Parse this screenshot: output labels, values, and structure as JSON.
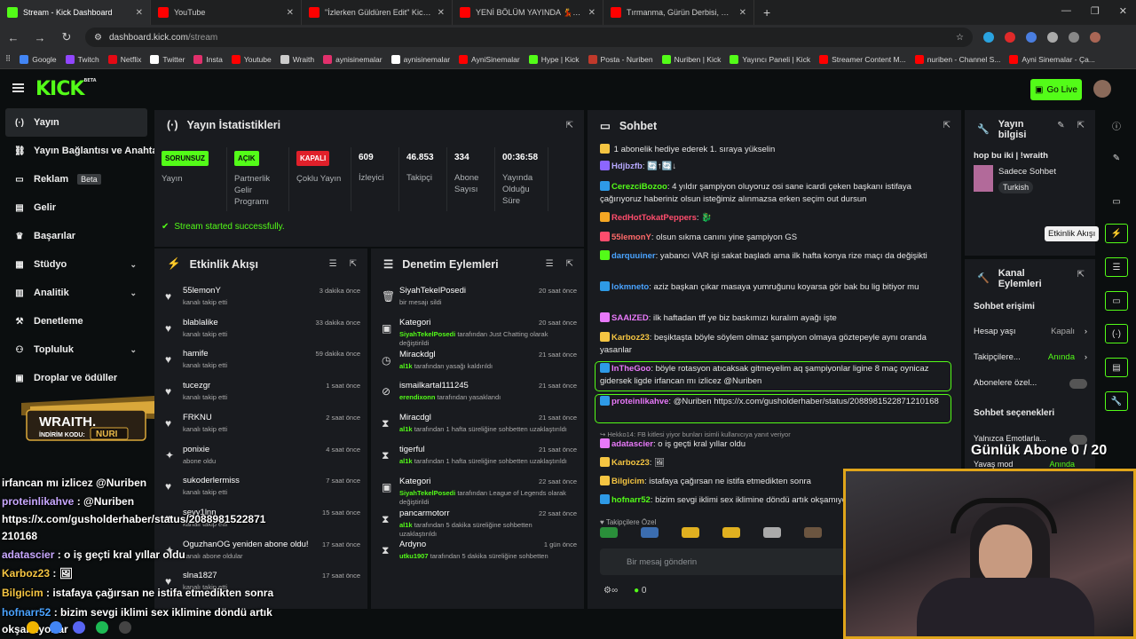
{
  "browser": {
    "tabs": [
      {
        "title": "Stream - Kick Dashboard",
        "color": "#53fc18"
      },
      {
        "title": "YouTube",
        "color": "#ff0000"
      },
      {
        "title": "\"İzlerken Güldüren Edit\" Kick &",
        "color": "#ff0000"
      },
      {
        "title": "YENİ BÖLÜM YAYINDA 💃 @C",
        "color": "#ff0000"
      },
      {
        "title": "Tırmanma, Gürün Derbisi, Yüksı",
        "color": "#ff0000"
      }
    ],
    "url_host": "dashboard.kick.com",
    "url_path": "/stream",
    "bookmarks": [
      {
        "label": "Google",
        "color": "#4285f4"
      },
      {
        "label": "Twitch",
        "color": "#9146ff"
      },
      {
        "label": "Netflix",
        "color": "#e50914"
      },
      {
        "label": "Twitter",
        "color": "#ffffff"
      },
      {
        "label": "Insta",
        "color": "#e1306c"
      },
      {
        "label": "Youtube",
        "color": "#ff0000"
      },
      {
        "label": "Wraith",
        "color": "#cccccc"
      },
      {
        "label": "aynisinemalar",
        "color": "#e1306c"
      },
      {
        "label": "aynisinemalar",
        "color": "#ffffff"
      },
      {
        "label": "AyniSinemalar",
        "color": "#ff0000"
      },
      {
        "label": "Hype | Kick",
        "color": "#53fc18"
      },
      {
        "label": "Posta - Nuriben",
        "color": "#c0392b"
      },
      {
        "label": "Nuriben | Kick",
        "color": "#53fc18"
      },
      {
        "label": "Yayıncı Paneli | Kick",
        "color": "#53fc18"
      },
      {
        "label": "Streamer Content M...",
        "color": "#ff0000"
      },
      {
        "label": "nuriben - Channel S...",
        "color": "#ff0000"
      },
      {
        "label": "Ayni Sinemalar - Ça...",
        "color": "#ff0000"
      }
    ]
  },
  "header": {
    "logo": "KICK",
    "logo_sup": "BETA",
    "go_live": "Go Live"
  },
  "sidebar": {
    "items": [
      {
        "label": "Yayın",
        "icon": "broadcast-icon"
      },
      {
        "label": "Yayın Bağlantısı ve Anahtarı",
        "icon": "link-icon"
      },
      {
        "label": "Reklam",
        "icon": "ad-icon",
        "badge": "Beta"
      },
      {
        "label": "Gelir",
        "icon": "money-icon"
      },
      {
        "label": "Başarılar",
        "icon": "trophy-icon"
      },
      {
        "label": "Stüdyo",
        "icon": "studio-icon"
      },
      {
        "label": "Analitik",
        "icon": "chart-icon"
      },
      {
        "label": "Denetleme",
        "icon": "hammer-icon"
      },
      {
        "label": "Topluluk",
        "icon": "community-icon"
      },
      {
        "label": "Droplar ve ödüller",
        "icon": "gift-icon"
      }
    ]
  },
  "stats": {
    "title": "Yayın İstatistikleri",
    "items": [
      {
        "badge": "SORUNSUZ",
        "badge_color": "#53fc18",
        "label": "Yayın"
      },
      {
        "badge": "AÇIK",
        "badge_color": "#53fc18",
        "label": "Partnerlik Gelir Programı"
      },
      {
        "badge": "KAPALI",
        "badge_color": "#e0202a",
        "label": "Çoklu Yayın"
      },
      {
        "value": "609",
        "label": "İzleyici"
      },
      {
        "value": "46.853",
        "label": "Takipçi"
      },
      {
        "value": "334",
        "label": "Abone Sayısı"
      },
      {
        "value": "00:36:58",
        "label": "Yayında Olduğu Süre"
      }
    ],
    "success": "Stream started successfully."
  },
  "activity": {
    "title": "Etkinlik Akışı",
    "rows": [
      {
        "name": "55lemonY",
        "sub": "kanalı takip etti",
        "time": "3 dakika önce",
        "icon": "heart-icon"
      },
      {
        "name": "blablalike",
        "sub": "kanalı takip etti",
        "time": "33 dakika önce",
        "icon": "heart-icon"
      },
      {
        "name": "hamife",
        "sub": "kanalı takip etti",
        "time": "59 dakika önce",
        "icon": "heart-icon"
      },
      {
        "name": "tucezgr",
        "sub": "kanalı takip etti",
        "time": "1 saat önce",
        "icon": "heart-icon"
      },
      {
        "name": "FRKNU",
        "sub": "kanalı takip etti",
        "time": "2 saat önce",
        "icon": "heart-icon"
      },
      {
        "name": "ponixie",
        "sub": "abone oldu",
        "time": "4 saat önce",
        "icon": "sparkle-icon"
      },
      {
        "name": "sukoderlermiss",
        "sub": "kanalı takip etti",
        "time": "7 saat önce",
        "icon": "heart-icon"
      },
      {
        "name": "seyy1lnn",
        "sub": "kanalı takip etti",
        "time": "15 saat önce",
        "icon": "heart-icon"
      },
      {
        "name": "OguzhanOG yeniden abone oldu!",
        "sub": "kanalı abone oldular",
        "time": "17 saat önce",
        "icon": "sparkle-icon"
      },
      {
        "name": "slna1827",
        "sub": "kanalı takip etti",
        "time": "17 saat önce",
        "icon": "heart-icon"
      }
    ]
  },
  "moderation": {
    "title": "Denetim Eylemleri",
    "rows": [
      {
        "name": "SiyahTekelPosedi",
        "sub": "bir mesajı sildi",
        "time": "20 saat önce",
        "icon": "trash-icon"
      },
      {
        "name": "Kategori",
        "sub_user": "SiyahTekelPosedi",
        "sub": " tarafından Just Chatting olarak değiştirildi",
        "time": "20 saat önce",
        "icon": "category-icon"
      },
      {
        "name": "Mirackdgl",
        "sub_user": "al1k",
        "sub": " tarafından yasağı kaldırıldı",
        "time": "21 saat önce",
        "icon": "clock-icon"
      },
      {
        "name": "ismailkartal111245",
        "sub_user": "erendixonn",
        "sub": " tarafından yasaklandı",
        "time": "21 saat önce",
        "icon": "ban-icon"
      },
      {
        "name": "Miracdgl",
        "sub_user": "al1k",
        "sub": " tarafından 1 hafta süreliğine sohbetten uzaklaştırıldı",
        "time": "21 saat önce",
        "icon": "hourglass-icon"
      },
      {
        "name": "tigerful",
        "sub_user": "al1k",
        "sub": " tarafından 1 hafta süreliğine sohbetten uzaklaştırıldı",
        "time": "21 saat önce",
        "icon": "hourglass-icon"
      },
      {
        "name": "Kategori",
        "sub_user": "SiyahTekelPosedi",
        "sub": " tarafından League of Legends olarak değiştirildi",
        "time": "22 saat önce",
        "icon": "category-icon"
      },
      {
        "name": "pancarmotorr",
        "sub_user": "al1k",
        "sub": " tarafından 5 dakika süreliğine sohbetten uzaklaştırıldı",
        "time": "22 saat önce",
        "icon": "hourglass-icon"
      },
      {
        "name": "Ardyno",
        "sub_user": "utku1907",
        "sub": " tarafından 5 dakika süreliğine sohbetten",
        "time": "1 gün önce",
        "icon": "hourglass-icon"
      }
    ]
  },
  "chat": {
    "title": "Sohbet",
    "pinned": "1 abonelik hediye ederek 1. sıraya yükselin",
    "messages": [
      {
        "user": "Hdjbzfb",
        "color": "#b7a8ff",
        "text": "🔄↑🔄↓"
      },
      {
        "user": "CerezciBozoo",
        "color": "#53fc18",
        "text": "4 yıldır şampiyon oluyoruz osi sane icardi çeken başkanı istifaya çağırıyoruz haberiniz olsun isteğimiz alınmazsa erken seçim out dursun"
      },
      {
        "user": "RedHotTokatPeppers",
        "color": "#ff4d6d",
        "text": "🐉"
      },
      {
        "user": "55lemonY",
        "color": "#ff6a6a",
        "text": "olsun sıkma canını yine şampiyon GS"
      },
      {
        "user": "darquuiner",
        "color": "#4aa3ff",
        "text": "yabancı VAR işi sakat başladı ama ilk hafta konya rize maçı da değişikti"
      },
      {
        "user": "lokmneto",
        "color": "#4aa3ff",
        "text": "aziz başkan çıkar masaya yumruğunu koyarsa gör bak bu lig bitiyor mu"
      },
      {
        "user": "SAAIZED",
        "color": "#e879f9",
        "text": "ilk haftadan tff ye biz baskımızı kuralım ayağı işte"
      },
      {
        "user": "Karboz23",
        "color": "#f5c542",
        "text": "beşiktaşta böyle söylem olmaz şampiyon olmaya göztepeyle aynı oranda yasanlar"
      },
      {
        "user": "InTheGoo",
        "color": "#e879f9",
        "text": "böyle rotasyon atıcaksak gitmeyelim aq şampiyonlar ligine 8 maç oynicaz gidersek ligde irfancan mı izlicez @Nuriben"
      },
      {
        "user": "proteinlikahve",
        "color": "#e879f9",
        "text": "@Nuriben https://x.com/gusholderhaber/status/2088981522871210168"
      },
      {
        "user": "adatascier",
        "color": "#e879f9",
        "text": "o iş geçti kral yıllar oldu"
      },
      {
        "user": "Karboz23",
        "color": "#f5c542",
        "text": "🖼"
      },
      {
        "user": "Bilgicim",
        "color": "#f5c542",
        "text": "istafaya çağırsan ne istifa etmedikten sonra"
      },
      {
        "user": "hofnarr52",
        "color": "#53fc18",
        "text": "bizim sevgi iklimi sex iklimine döndü artık okşamıyorlar"
      }
    ],
    "reply_hint": "Hekko14: FB kitlesi yiyor bunları isimli kullanıcıya yanıt veriyor",
    "followers_only": "Takipçilere Özel",
    "input_placeholder": "Bir mesaj gönderin",
    "count": "0"
  },
  "info": {
    "title": "Yayın bilgisi",
    "stream_title": "hop bu iki | !wraith",
    "category": "Sadece Sohbet",
    "language": "Turkish"
  },
  "channel_actions": {
    "title": "Kanal Eylemleri",
    "section1": "Sohbet erişimi",
    "rows1": [
      {
        "label": "Hesap yaşı",
        "value": "Kapalı"
      },
      {
        "label": "Takipçilere...",
        "value": "Anında"
      },
      {
        "label": "Abonelere özel...",
        "value": ""
      }
    ],
    "section2": "Sohbet seçenekleri",
    "rows2": [
      {
        "label": "Yalnızca Emotlarla...",
        "value": ""
      },
      {
        "label": "Yavaş mod",
        "value": "Anında"
      }
    ]
  },
  "tooltip": "Etkinlik Akışı",
  "overlay": {
    "chat": [
      {
        "user": "",
        "text": "irfancan mı izlicez @Nuriben"
      },
      {
        "user": "proteinlikahve",
        "text": " : @Nuriben"
      },
      {
        "user": "",
        "text": "https://x.com/gusholderhaber/status/2088981522871"
      },
      {
        "user": "",
        "text": "210168"
      },
      {
        "user": "adatascier",
        "text": " : o iş geçti kral yıllar oldu"
      },
      {
        "user": "Karboz23",
        "text": " : 🖼"
      },
      {
        "user": "Bilgicim",
        "text": " : istafaya çağırsan ne istifa etmedikten sonra"
      },
      {
        "user": "hofnarr52",
        "text": " : bizim sevgi iklimi sex iklimine döndü artık"
      },
      {
        "user": "",
        "text": "okşamıyorlar"
      }
    ],
    "wraith_title": "WRAITH.",
    "wraith_code_label": "İNDİRİM KODU:",
    "wraith_code": "NURI",
    "daily_sub": "Günlük Abone 0 / 20"
  }
}
